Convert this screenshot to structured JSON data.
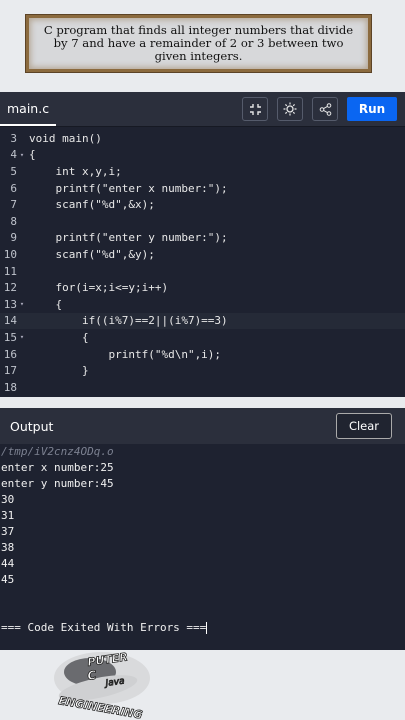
{
  "banner": {
    "text": "C program that finds all integer numbers that divide by 7 and have a remainder of 2 or 3 between two given integers."
  },
  "editor": {
    "tab": "main.c",
    "run_label": "Run",
    "lines": [
      {
        "n": "3",
        "fold": "",
        "text": "void main()"
      },
      {
        "n": "4",
        "fold": "▾",
        "text": "{"
      },
      {
        "n": "5",
        "fold": "",
        "text": "    int x,y,i;"
      },
      {
        "n": "6",
        "fold": "",
        "text": "    printf(\"enter x number:\");"
      },
      {
        "n": "7",
        "fold": "",
        "text": "    scanf(\"%d\",&x);"
      },
      {
        "n": "8",
        "fold": "",
        "text": ""
      },
      {
        "n": "9",
        "fold": "",
        "text": "    printf(\"enter y number:\");"
      },
      {
        "n": "10",
        "fold": "",
        "text": "    scanf(\"%d\",&y);"
      },
      {
        "n": "11",
        "fold": "",
        "text": ""
      },
      {
        "n": "12",
        "fold": "",
        "text": "    for(i=x;i<=y;i++)"
      },
      {
        "n": "13",
        "fold": "▾",
        "text": "    {"
      },
      {
        "n": "14",
        "fold": "",
        "text": "        if((i%7)==2||(i%7)==3)"
      },
      {
        "n": "15",
        "fold": "▾",
        "text": "        {"
      },
      {
        "n": "16",
        "fold": "",
        "text": "            printf(\"%d\\n\",i);"
      },
      {
        "n": "17",
        "fold": "",
        "text": "        }"
      },
      {
        "n": "18",
        "fold": "",
        "text": ""
      }
    ]
  },
  "output": {
    "label": "Output",
    "clear_label": "Clear",
    "path": "/tmp/iV2cnz4ODq.o",
    "lines": [
      "enter x number:25",
      "enter y number:45",
      "30",
      "31",
      "37",
      "38",
      "44",
      "45",
      "",
      "",
      "=== Code Exited With Errors ==="
    ]
  },
  "logo": {
    "text": [
      "PUTER",
      "C",
      "Java",
      "ENGINEERING"
    ]
  }
}
